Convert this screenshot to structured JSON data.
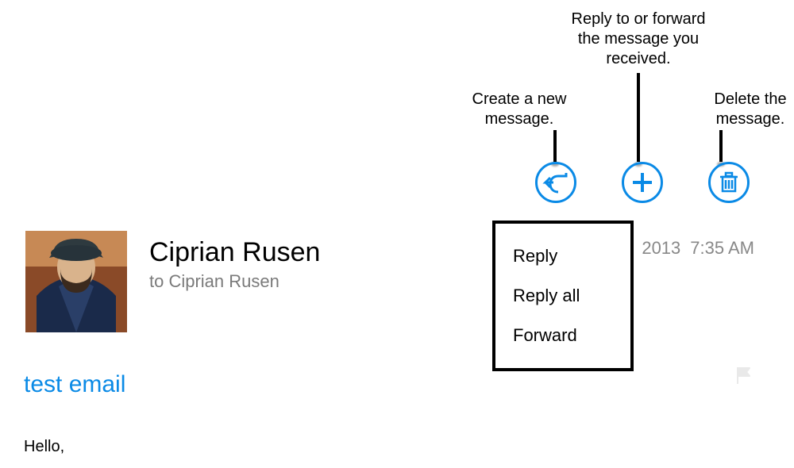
{
  "annotations": {
    "reply_forward": "Reply to or forward\nthe message you\nreceived.",
    "create_new": "Create a new\nmessage.",
    "delete": "Delete the\nmessage."
  },
  "sender": {
    "name": "Ciprian Rusen",
    "to_line": "to Ciprian Rusen"
  },
  "meta": {
    "year_fragment": "2013",
    "time": "7:35 AM"
  },
  "subject": "test email",
  "body_greeting": "Hello,",
  "dropdown": {
    "reply": "Reply",
    "reply_all": "Reply all",
    "forward": "Forward"
  }
}
